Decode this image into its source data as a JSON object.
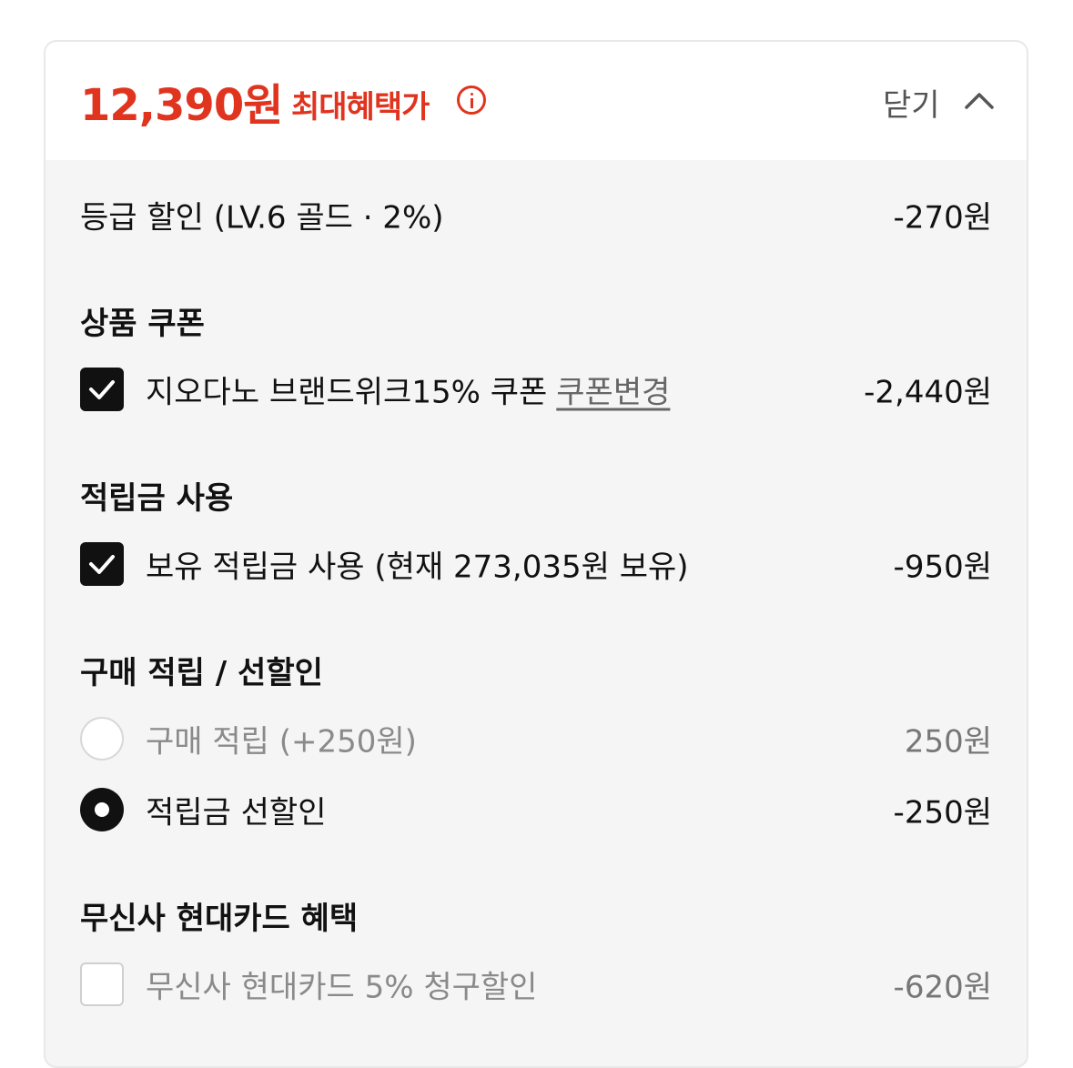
{
  "header": {
    "price": "12,390원",
    "price_label": "최대혜택가",
    "close_label": "닫기"
  },
  "grade_discount": {
    "label": "등급 할인 (LV.6 골드 · 2%)",
    "value": "-270원"
  },
  "product_coupon": {
    "title": "상품 쿠폰",
    "item_label": "지오다노 브랜드위크15% 쿠폰",
    "change_link": "쿠폰변경",
    "value": "-2,440원",
    "checked": true
  },
  "points_use": {
    "title": "적립금 사용",
    "item_label": "보유 적립금 사용 (현재 273,035원 보유)",
    "value": "-950원",
    "checked": true
  },
  "purchase_reward": {
    "title": "구매 적립 / 선할인",
    "options": [
      {
        "label": "구매 적립 (+250원)",
        "value": "250원",
        "selected": false
      },
      {
        "label": "적립금 선할인",
        "value": "-250원",
        "selected": true
      }
    ]
  },
  "card_benefit": {
    "title": "무신사 현대카드 혜택",
    "item_label": "무신사 현대카드 5% 청구할인",
    "value": "-620원",
    "checked": false
  }
}
